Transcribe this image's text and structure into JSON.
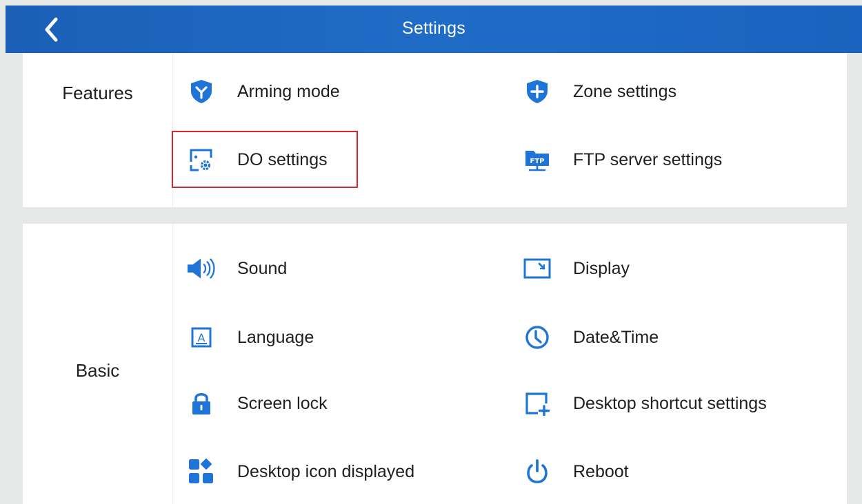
{
  "header": {
    "title": "Settings",
    "back_icon": "chevron-left-icon"
  },
  "colors": {
    "header_bg": "#1e67c2",
    "icon_blue": "#1f74d8",
    "highlight_border": "#d7262c",
    "page_bg": "#e6e8e8"
  },
  "features": {
    "label": "Features",
    "items": [
      {
        "label": "Arming mode",
        "icon": "shield-y-icon"
      },
      {
        "label": "Zone settings",
        "icon": "shield-plus-icon"
      },
      {
        "label": "DO settings",
        "icon": "do-settings-icon"
      },
      {
        "label": "FTP server settings",
        "icon": "ftp-folder-icon",
        "icon_text": "FTP"
      }
    ]
  },
  "basic": {
    "label": "Basic",
    "items": [
      {
        "label": "Sound",
        "icon": "speaker-icon"
      },
      {
        "label": "Display",
        "icon": "display-icon"
      },
      {
        "label": "Language",
        "icon": "language-icon",
        "icon_text": "A"
      },
      {
        "label": "Date&Time",
        "icon": "clock-icon"
      },
      {
        "label": "Screen lock",
        "icon": "lock-icon"
      },
      {
        "label": "Desktop shortcut settings",
        "icon": "shortcut-plus-icon"
      },
      {
        "label": "Desktop icon displayed",
        "icon": "desktop-icons-icon"
      },
      {
        "label": "Reboot",
        "icon": "power-icon"
      }
    ]
  }
}
